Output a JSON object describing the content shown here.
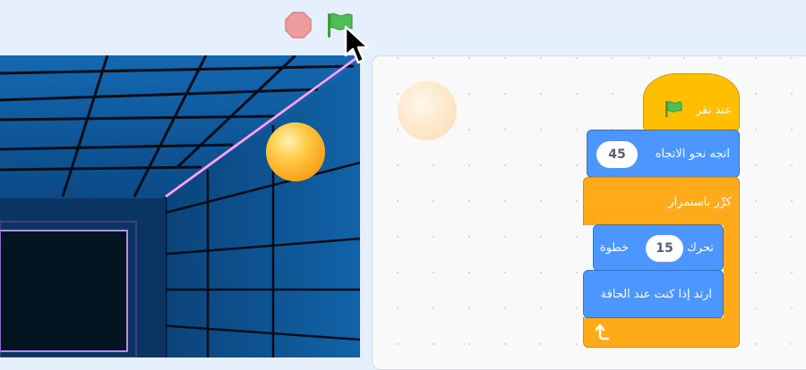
{
  "toolbar": {
    "stop_icon": "stop-octagon-icon",
    "green_flag_icon": "green-flag-icon"
  },
  "colors": {
    "toolbar_bg": "#e6f0fc",
    "events_yellow": "#ffbf00",
    "motion_blue": "#4c97ff",
    "control_orange": "#ffab19",
    "stop_red": "#ec9c9c",
    "flag_green": "#4cbf56"
  },
  "script": {
    "when_flag_clicked": "عند نقر",
    "point_in_direction": "اتجه نحو الاتجاه",
    "direction_value": "45",
    "forever": "كرِّر باستمرار",
    "move_label": "تحرك",
    "move_steps_value": "15",
    "move_steps_unit": "خطوة",
    "bounce_on_edge": "ارتد إذا كنت عند الحافة"
  },
  "stage": {
    "sprite": "orange-ball",
    "backdrop": "neon-tunnel-grid"
  }
}
